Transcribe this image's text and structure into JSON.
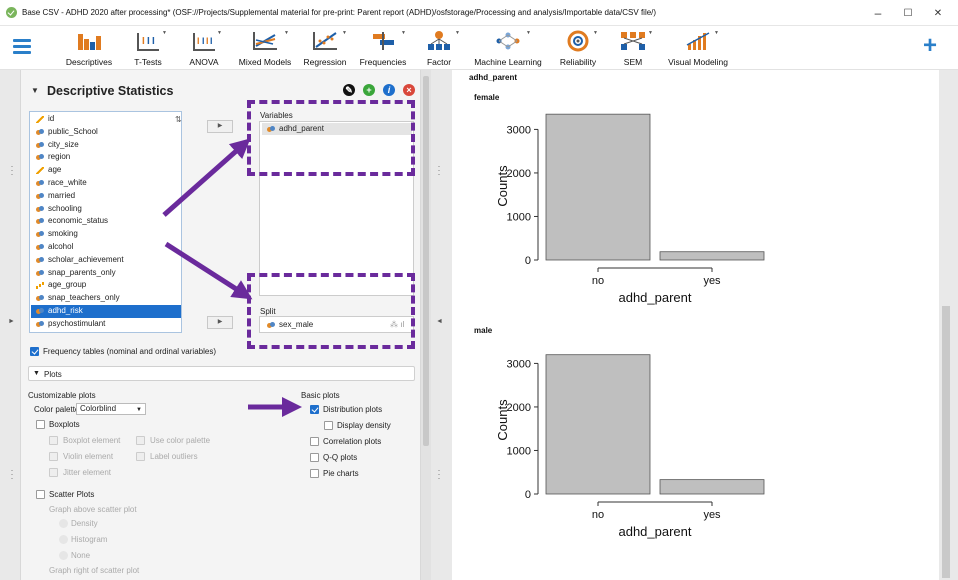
{
  "window": {
    "title": "Base CSV - ADHD 2020 after processing*   (OSF://Projects/Supplemental material for pre-print: Parent report (ADHD)/osfstorage/Processing and analysis/Importable data/CSV file/)",
    "controls": [
      "–",
      "☐",
      "✕"
    ]
  },
  "ribbon": {
    "items": [
      "Descriptives",
      "T-Tests",
      "ANOVA",
      "Mixed Models",
      "Regression",
      "Frequencies",
      "Factor",
      "Machine Learning",
      "Reliability",
      "SEM",
      "Visual Modeling"
    ]
  },
  "analysis": {
    "title": "Descriptive Statistics",
    "header_icons": [
      "edit-icon",
      "duplicate-icon",
      "info-icon",
      "close-icon"
    ],
    "variables_label": "Variables",
    "split_label": "Split",
    "all_variables": [
      {
        "name": "id",
        "type": "scale"
      },
      {
        "name": "public_School",
        "type": "nominal"
      },
      {
        "name": "city_size",
        "type": "nominal"
      },
      {
        "name": "region",
        "type": "nominal"
      },
      {
        "name": "age",
        "type": "scale"
      },
      {
        "name": "race_white",
        "type": "nominal"
      },
      {
        "name": "married",
        "type": "nominal"
      },
      {
        "name": "schooling",
        "type": "nominal"
      },
      {
        "name": "economic_status",
        "type": "nominal"
      },
      {
        "name": "smoking",
        "type": "nominal"
      },
      {
        "name": "alcohol",
        "type": "nominal"
      },
      {
        "name": "scholar_achievement",
        "type": "nominal"
      },
      {
        "name": "snap_parents_only",
        "type": "nominal"
      },
      {
        "name": "age_group",
        "type": "ordinal"
      },
      {
        "name": "snap_teachers_only",
        "type": "nominal"
      },
      {
        "name": "adhd_risk",
        "type": "nominal",
        "selected": true
      },
      {
        "name": "psychostimulant",
        "type": "nominal"
      }
    ],
    "selected_variable": "adhd_parent",
    "split_variable": "sex_male",
    "frequency_tables": {
      "label": "Frequency tables (nominal and ordinal variables)",
      "checked": true
    },
    "plots_section": "Plots",
    "customizable_plots": {
      "heading": "Customizable plots",
      "palette_label": "Color palette",
      "palette_value": "Colorblind",
      "boxplots": "Boxplots",
      "boxplot_element": "Boxplot element",
      "use_color_palette": "Use color palette",
      "violin_element": "Violin element",
      "label_outliers": "Label outliers",
      "jitter_element": "Jitter element",
      "scatter_plots": "Scatter Plots",
      "graph_above": "Graph above scatter plot",
      "density": "Density",
      "histogram": "Histogram",
      "none": "None",
      "graph_right": "Graph right of scatter plot"
    },
    "basic_plots": {
      "heading": "Basic plots",
      "distribution": "Distribution plots",
      "distribution_checked": true,
      "display_density": "Display density",
      "correlation": "Correlation plots",
      "qq": "Q-Q plots",
      "pie": "Pie charts"
    }
  },
  "results": {
    "variable_title": "adhd_parent",
    "panels": [
      "female",
      "male"
    ]
  },
  "chart_data": [
    {
      "type": "bar",
      "title": "female",
      "categories": [
        "no",
        "yes"
      ],
      "values": [
        3350,
        190
      ],
      "xlabel": "adhd_parent",
      "ylabel": "Counts",
      "yticks": [
        0,
        1000,
        2000,
        3000
      ],
      "ylim": [
        0,
        3400
      ],
      "bar_color": "#bfbfbf"
    },
    {
      "type": "bar",
      "title": "male",
      "categories": [
        "no",
        "yes"
      ],
      "values": [
        3200,
        330
      ],
      "xlabel": "adhd_parent",
      "ylabel": "Counts",
      "yticks": [
        0,
        1000,
        2000,
        3000
      ],
      "ylim": [
        0,
        3400
      ],
      "bar_color": "#bfbfbf"
    }
  ],
  "colors": {
    "accent": "#1e6fcc",
    "annotation": "#6a2a9c"
  }
}
